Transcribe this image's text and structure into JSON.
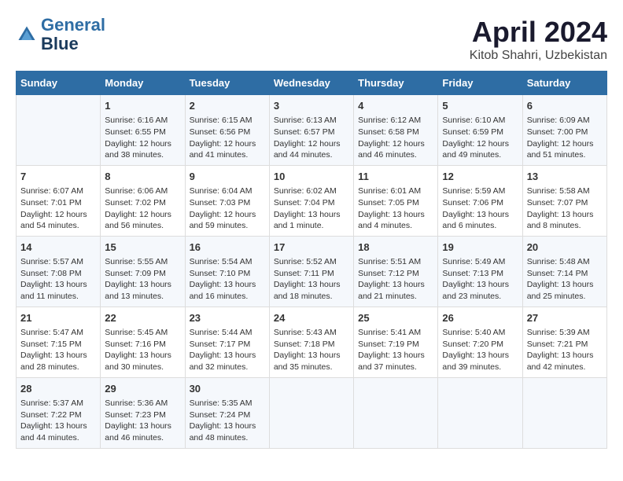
{
  "header": {
    "logo_line1": "General",
    "logo_line2": "Blue",
    "title": "April 2024",
    "subtitle": "Kitob Shahri, Uzbekistan"
  },
  "days_of_week": [
    "Sunday",
    "Monday",
    "Tuesday",
    "Wednesday",
    "Thursday",
    "Friday",
    "Saturday"
  ],
  "weeks": [
    [
      {
        "day": "",
        "content": ""
      },
      {
        "day": "1",
        "content": "Sunrise: 6:16 AM\nSunset: 6:55 PM\nDaylight: 12 hours\nand 38 minutes."
      },
      {
        "day": "2",
        "content": "Sunrise: 6:15 AM\nSunset: 6:56 PM\nDaylight: 12 hours\nand 41 minutes."
      },
      {
        "day": "3",
        "content": "Sunrise: 6:13 AM\nSunset: 6:57 PM\nDaylight: 12 hours\nand 44 minutes."
      },
      {
        "day": "4",
        "content": "Sunrise: 6:12 AM\nSunset: 6:58 PM\nDaylight: 12 hours\nand 46 minutes."
      },
      {
        "day": "5",
        "content": "Sunrise: 6:10 AM\nSunset: 6:59 PM\nDaylight: 12 hours\nand 49 minutes."
      },
      {
        "day": "6",
        "content": "Sunrise: 6:09 AM\nSunset: 7:00 PM\nDaylight: 12 hours\nand 51 minutes."
      }
    ],
    [
      {
        "day": "7",
        "content": "Sunrise: 6:07 AM\nSunset: 7:01 PM\nDaylight: 12 hours\nand 54 minutes."
      },
      {
        "day": "8",
        "content": "Sunrise: 6:06 AM\nSunset: 7:02 PM\nDaylight: 12 hours\nand 56 minutes."
      },
      {
        "day": "9",
        "content": "Sunrise: 6:04 AM\nSunset: 7:03 PM\nDaylight: 12 hours\nand 59 minutes."
      },
      {
        "day": "10",
        "content": "Sunrise: 6:02 AM\nSunset: 7:04 PM\nDaylight: 13 hours\nand 1 minute."
      },
      {
        "day": "11",
        "content": "Sunrise: 6:01 AM\nSunset: 7:05 PM\nDaylight: 13 hours\nand 4 minutes."
      },
      {
        "day": "12",
        "content": "Sunrise: 5:59 AM\nSunset: 7:06 PM\nDaylight: 13 hours\nand 6 minutes."
      },
      {
        "day": "13",
        "content": "Sunrise: 5:58 AM\nSunset: 7:07 PM\nDaylight: 13 hours\nand 8 minutes."
      }
    ],
    [
      {
        "day": "14",
        "content": "Sunrise: 5:57 AM\nSunset: 7:08 PM\nDaylight: 13 hours\nand 11 minutes."
      },
      {
        "day": "15",
        "content": "Sunrise: 5:55 AM\nSunset: 7:09 PM\nDaylight: 13 hours\nand 13 minutes."
      },
      {
        "day": "16",
        "content": "Sunrise: 5:54 AM\nSunset: 7:10 PM\nDaylight: 13 hours\nand 16 minutes."
      },
      {
        "day": "17",
        "content": "Sunrise: 5:52 AM\nSunset: 7:11 PM\nDaylight: 13 hours\nand 18 minutes."
      },
      {
        "day": "18",
        "content": "Sunrise: 5:51 AM\nSunset: 7:12 PM\nDaylight: 13 hours\nand 21 minutes."
      },
      {
        "day": "19",
        "content": "Sunrise: 5:49 AM\nSunset: 7:13 PM\nDaylight: 13 hours\nand 23 minutes."
      },
      {
        "day": "20",
        "content": "Sunrise: 5:48 AM\nSunset: 7:14 PM\nDaylight: 13 hours\nand 25 minutes."
      }
    ],
    [
      {
        "day": "21",
        "content": "Sunrise: 5:47 AM\nSunset: 7:15 PM\nDaylight: 13 hours\nand 28 minutes."
      },
      {
        "day": "22",
        "content": "Sunrise: 5:45 AM\nSunset: 7:16 PM\nDaylight: 13 hours\nand 30 minutes."
      },
      {
        "day": "23",
        "content": "Sunrise: 5:44 AM\nSunset: 7:17 PM\nDaylight: 13 hours\nand 32 minutes."
      },
      {
        "day": "24",
        "content": "Sunrise: 5:43 AM\nSunset: 7:18 PM\nDaylight: 13 hours\nand 35 minutes."
      },
      {
        "day": "25",
        "content": "Sunrise: 5:41 AM\nSunset: 7:19 PM\nDaylight: 13 hours\nand 37 minutes."
      },
      {
        "day": "26",
        "content": "Sunrise: 5:40 AM\nSunset: 7:20 PM\nDaylight: 13 hours\nand 39 minutes."
      },
      {
        "day": "27",
        "content": "Sunrise: 5:39 AM\nSunset: 7:21 PM\nDaylight: 13 hours\nand 42 minutes."
      }
    ],
    [
      {
        "day": "28",
        "content": "Sunrise: 5:37 AM\nSunset: 7:22 PM\nDaylight: 13 hours\nand 44 minutes."
      },
      {
        "day": "29",
        "content": "Sunrise: 5:36 AM\nSunset: 7:23 PM\nDaylight: 13 hours\nand 46 minutes."
      },
      {
        "day": "30",
        "content": "Sunrise: 5:35 AM\nSunset: 7:24 PM\nDaylight: 13 hours\nand 48 minutes."
      },
      {
        "day": "",
        "content": ""
      },
      {
        "day": "",
        "content": ""
      },
      {
        "day": "",
        "content": ""
      },
      {
        "day": "",
        "content": ""
      }
    ]
  ]
}
